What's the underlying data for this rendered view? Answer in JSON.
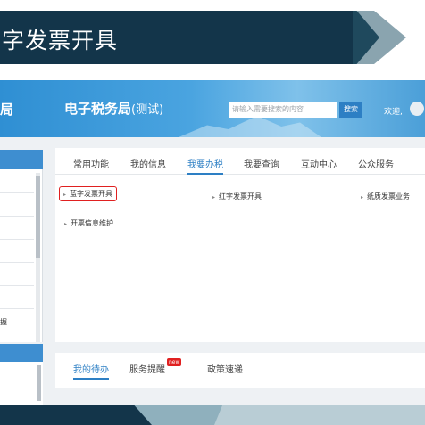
{
  "slide": {
    "title": "字发票开具"
  },
  "site": {
    "left_word": "局",
    "name": "电子税务局",
    "name_sub": "(测试)",
    "search_placeholder": "请输入需要搜索的内容",
    "search_button": "搜索",
    "welcome": "欢迎,"
  },
  "tabs": [
    {
      "label": "常用功能",
      "active": false
    },
    {
      "label": "我的信息",
      "active": false
    },
    {
      "label": "我要办税",
      "active": true
    },
    {
      "label": "我要查询",
      "active": false
    },
    {
      "label": "互动中心",
      "active": false
    },
    {
      "label": "公众服务",
      "active": false
    }
  ],
  "functions": [
    {
      "label": "蓝字发票开具",
      "highlighted": true
    },
    {
      "label": "红字发票开具",
      "highlighted": false
    },
    {
      "label": "纸质发票业务",
      "highlighted": false
    },
    {
      "label": "开票信息维护",
      "highlighted": false
    }
  ],
  "left_panel": {
    "fragment": "握"
  },
  "bottom_tabs": [
    {
      "label": "我的待办",
      "active": true
    },
    {
      "label": "服务提醒",
      "active": false,
      "badge": "new"
    },
    {
      "label": "政策速递",
      "active": false
    }
  ],
  "colors": {
    "accent": "#2d7fc4",
    "highlight": "#e02020",
    "header": "#13354a"
  }
}
